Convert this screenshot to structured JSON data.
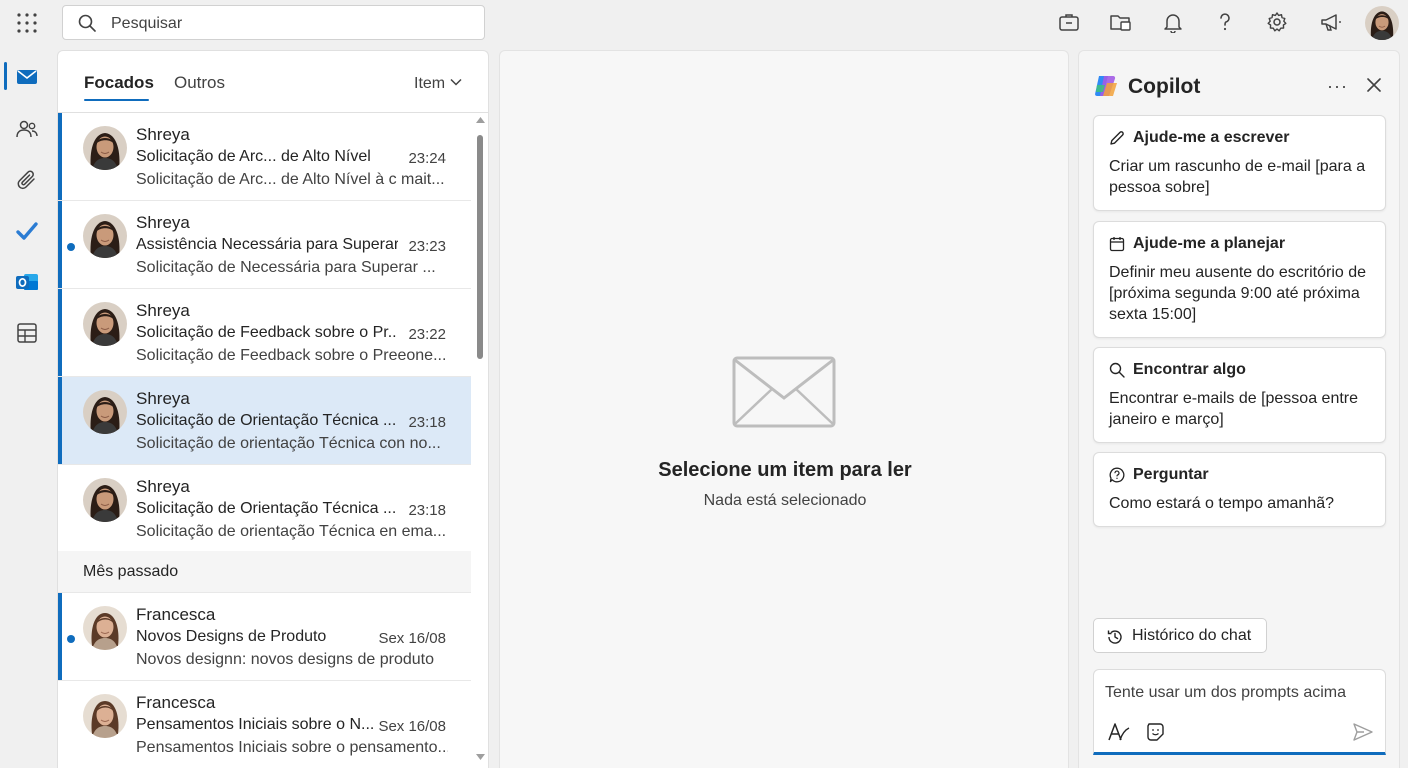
{
  "search": {
    "placeholder": "Pesquisar"
  },
  "icons": {
    "top": [
      "briefcase-icon",
      "folder-share-icon",
      "bell-icon",
      "help-icon",
      "settings-icon",
      "megaphone-icon"
    ],
    "rail": [
      "mail-icon",
      "people-icon",
      "attachment-icon",
      "todo-icon",
      "outlook-icon",
      "apps-grid-icon"
    ]
  },
  "colors": {
    "accent": "#0f6cbd",
    "selected_row": "#dce9f7"
  },
  "mail_list": {
    "tabs": {
      "focused": "Focados",
      "other": "Outros"
    },
    "filter_label": "Item",
    "section_last_month": "Mês passado",
    "messages": [
      {
        "sender": "Shreya",
        "subject": "Solicitação de Arc... de Alto Nível",
        "time": "23:24",
        "preview": "Solicitação de Arc...  de Alto Nível à c mait..."
      },
      {
        "sender": "Shreya",
        "subject": "Assistência Necessária para Superar...",
        "time": "23:23",
        "preview": "Solicitação de Necessária para Superar ..."
      },
      {
        "sender": "Shreya",
        "subject": "Solicitação de Feedback sobre o Pr...",
        "time": "23:22",
        "preview": "Solicitação de Feedback sobre o Preeone..."
      },
      {
        "sender": "Shreya",
        "subject": "Solicitação de Orientação Técnica ...",
        "time": "23:18",
        "preview": "Solicitação de orientação Técnica con no..."
      },
      {
        "sender": "Shreya",
        "subject": "Solicitação de Orientação Técnica ...",
        "time": "23:18",
        "preview": "Solicitação de orientação Técnica en ema..."
      },
      {
        "sender": "Francesca",
        "subject": "Novos Designs de Produto",
        "time": "Sex 16/08",
        "preview": "Novos designn: novos designs de produto"
      },
      {
        "sender": "Francesca",
        "subject": "Pensamentos Iniciais sobre o N...",
        "time": "Sex 16/08",
        "preview": "Pensamentos Iniciais sobre o pensamento..."
      }
    ]
  },
  "reading_pane": {
    "title": "Selecione um item para ler",
    "subtitle": "Nada está selecionado"
  },
  "copilot": {
    "title": "Copilot",
    "more": "···",
    "cards": [
      {
        "title": "Ajude-me a escrever",
        "body": "Criar um rascunho de e-mail [para a pessoa sobre]"
      },
      {
        "title": "Ajude-me a planejar",
        "body": "Definir meu ausente do escritório de [próxima segunda 9:00 até próxima sexta 15:00]"
      },
      {
        "title": "Encontrar algo",
        "body": "Encontrar e-mails de [pessoa entre janeiro e março]"
      },
      {
        "title": "Perguntar",
        "body": "Como estará o tempo amanhã?"
      }
    ],
    "history_label": "Histórico do chat",
    "composer_placeholder": "Tente usar um dos prompts acima"
  }
}
